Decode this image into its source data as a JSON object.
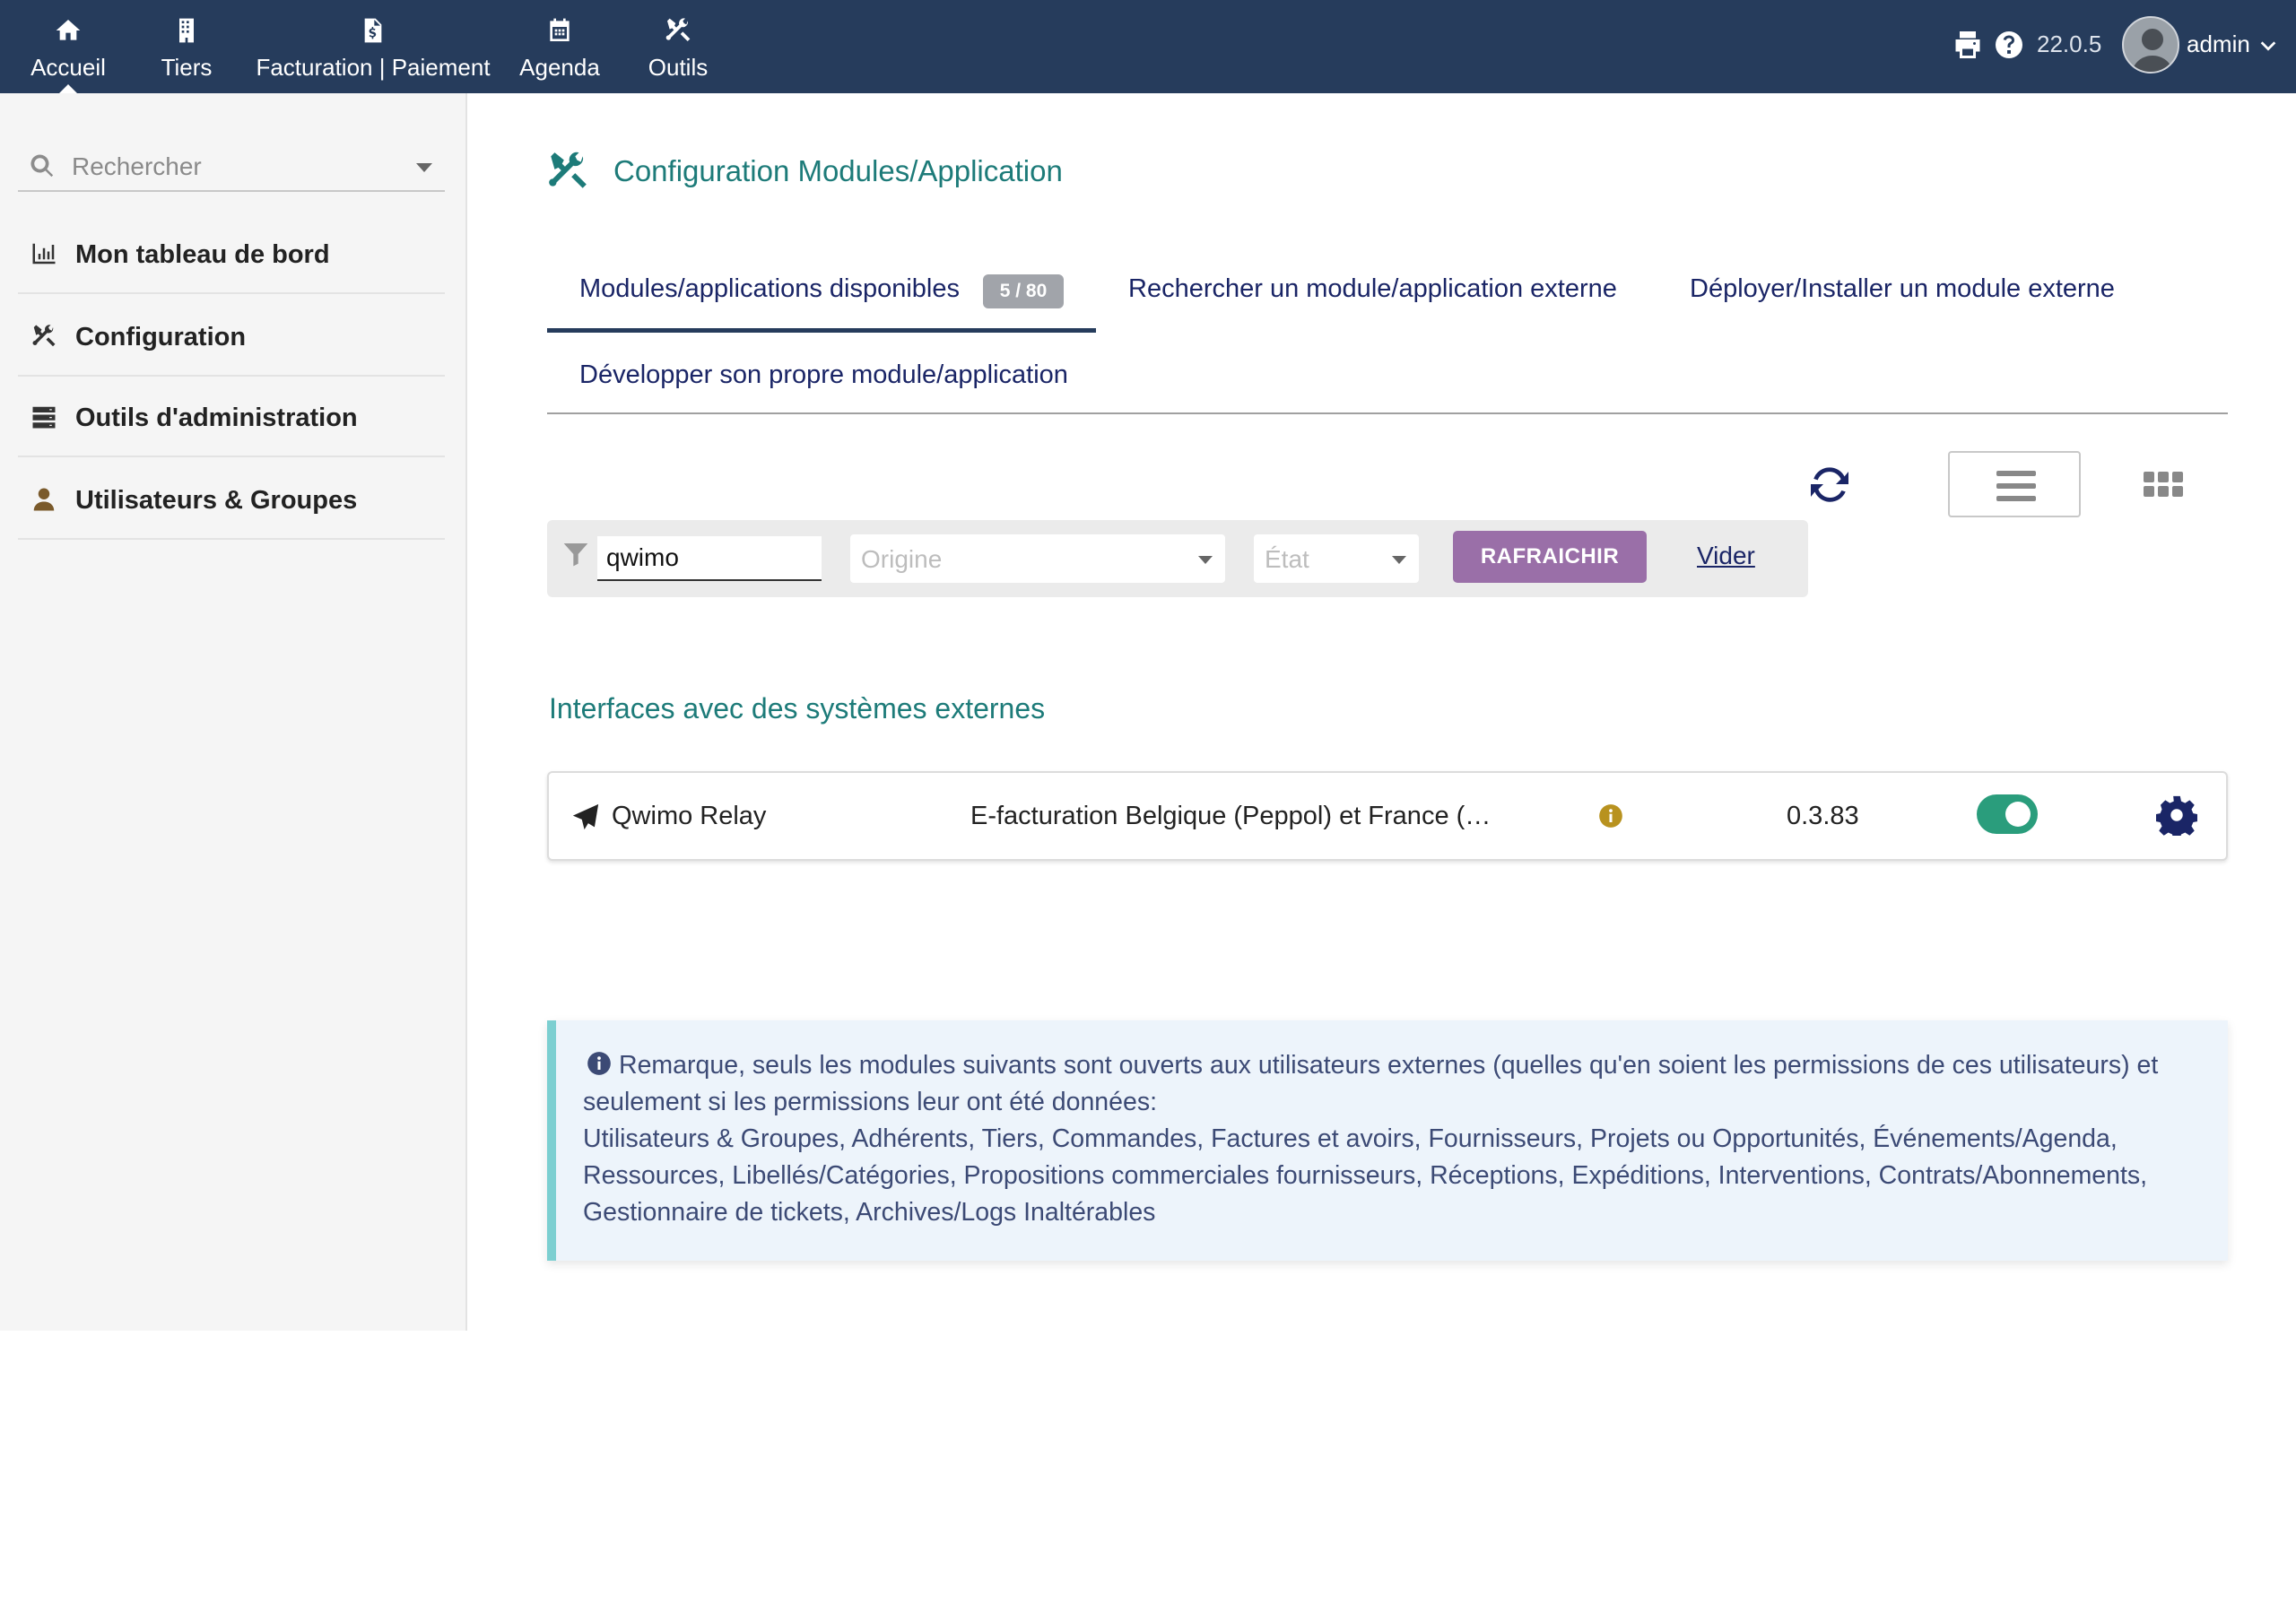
{
  "topnav": {
    "items": [
      {
        "label": "Accueil",
        "icon": "home-icon",
        "active": true
      },
      {
        "label": "Tiers",
        "icon": "building-icon"
      },
      {
        "label": "Facturation | Paiement",
        "icon": "invoice-dollar-icon"
      },
      {
        "label": "Agenda",
        "icon": "calendar-icon"
      },
      {
        "label": "Outils",
        "icon": "tools-icon"
      }
    ],
    "version": "22.0.5",
    "username": "admin"
  },
  "sidebar": {
    "search_placeholder": "Rechercher",
    "items": [
      {
        "label": "Mon tableau de bord",
        "icon": "chart-bar-icon"
      },
      {
        "label": "Configuration",
        "icon": "tools-icon"
      },
      {
        "label": "Outils d'administration",
        "icon": "server-icon"
      },
      {
        "label": "Utilisateurs & Groupes",
        "icon": "user-icon"
      }
    ]
  },
  "main": {
    "title": "Configuration Modules/Application",
    "tabs": [
      {
        "label": "Modules/applications disponibles",
        "badge": "5 / 80",
        "active": true
      },
      {
        "label": "Rechercher un module/application externe"
      },
      {
        "label": "Déployer/Installer un module externe"
      },
      {
        "label": "Développer son propre module/application"
      }
    ],
    "filter": {
      "search_value": "qwimo",
      "origin_placeholder": "Origine",
      "state_placeholder": "État",
      "refresh_label": "RAFRAICHIR",
      "clear_label": "Vider"
    },
    "section_title": "Interfaces avec des systèmes externes",
    "modules": [
      {
        "name": "Qwimo Relay",
        "description": "E-facturation Belgique (Peppol) et France (…",
        "version": "0.3.83",
        "enabled": true,
        "icon": "paper-plane-icon"
      }
    ],
    "note": {
      "line1": "Remarque, seuls les modules suivants sont ouverts aux utilisateurs externes (quelles qu'en soient les permissions de ces utilisateurs) et",
      "line2": "seulement si les permissions leur ont été données:",
      "line3": "Utilisateurs & Groupes, Adhérents, Tiers, Commandes, Factures et avoirs, Fournisseurs, Projets ou Opportunités, Événements/Agenda,",
      "line4": "Ressources, Libellés/Catégories, Propositions commerciales fournisseurs, Réceptions, Expéditions, Interventions, Contrats/Abonnements,",
      "line5": "Gestionnaire de tickets, Archives/Logs Inaltérables"
    }
  },
  "colors": {
    "topbar": "#263c5c",
    "accent_teal": "#1d7b79",
    "link_navy": "#1a2566",
    "refresh_button": "#9a6fa8",
    "toggle_on": "#2a9d7c",
    "note_bg": "#edf4fb",
    "note_border": "#7ccfd1"
  }
}
